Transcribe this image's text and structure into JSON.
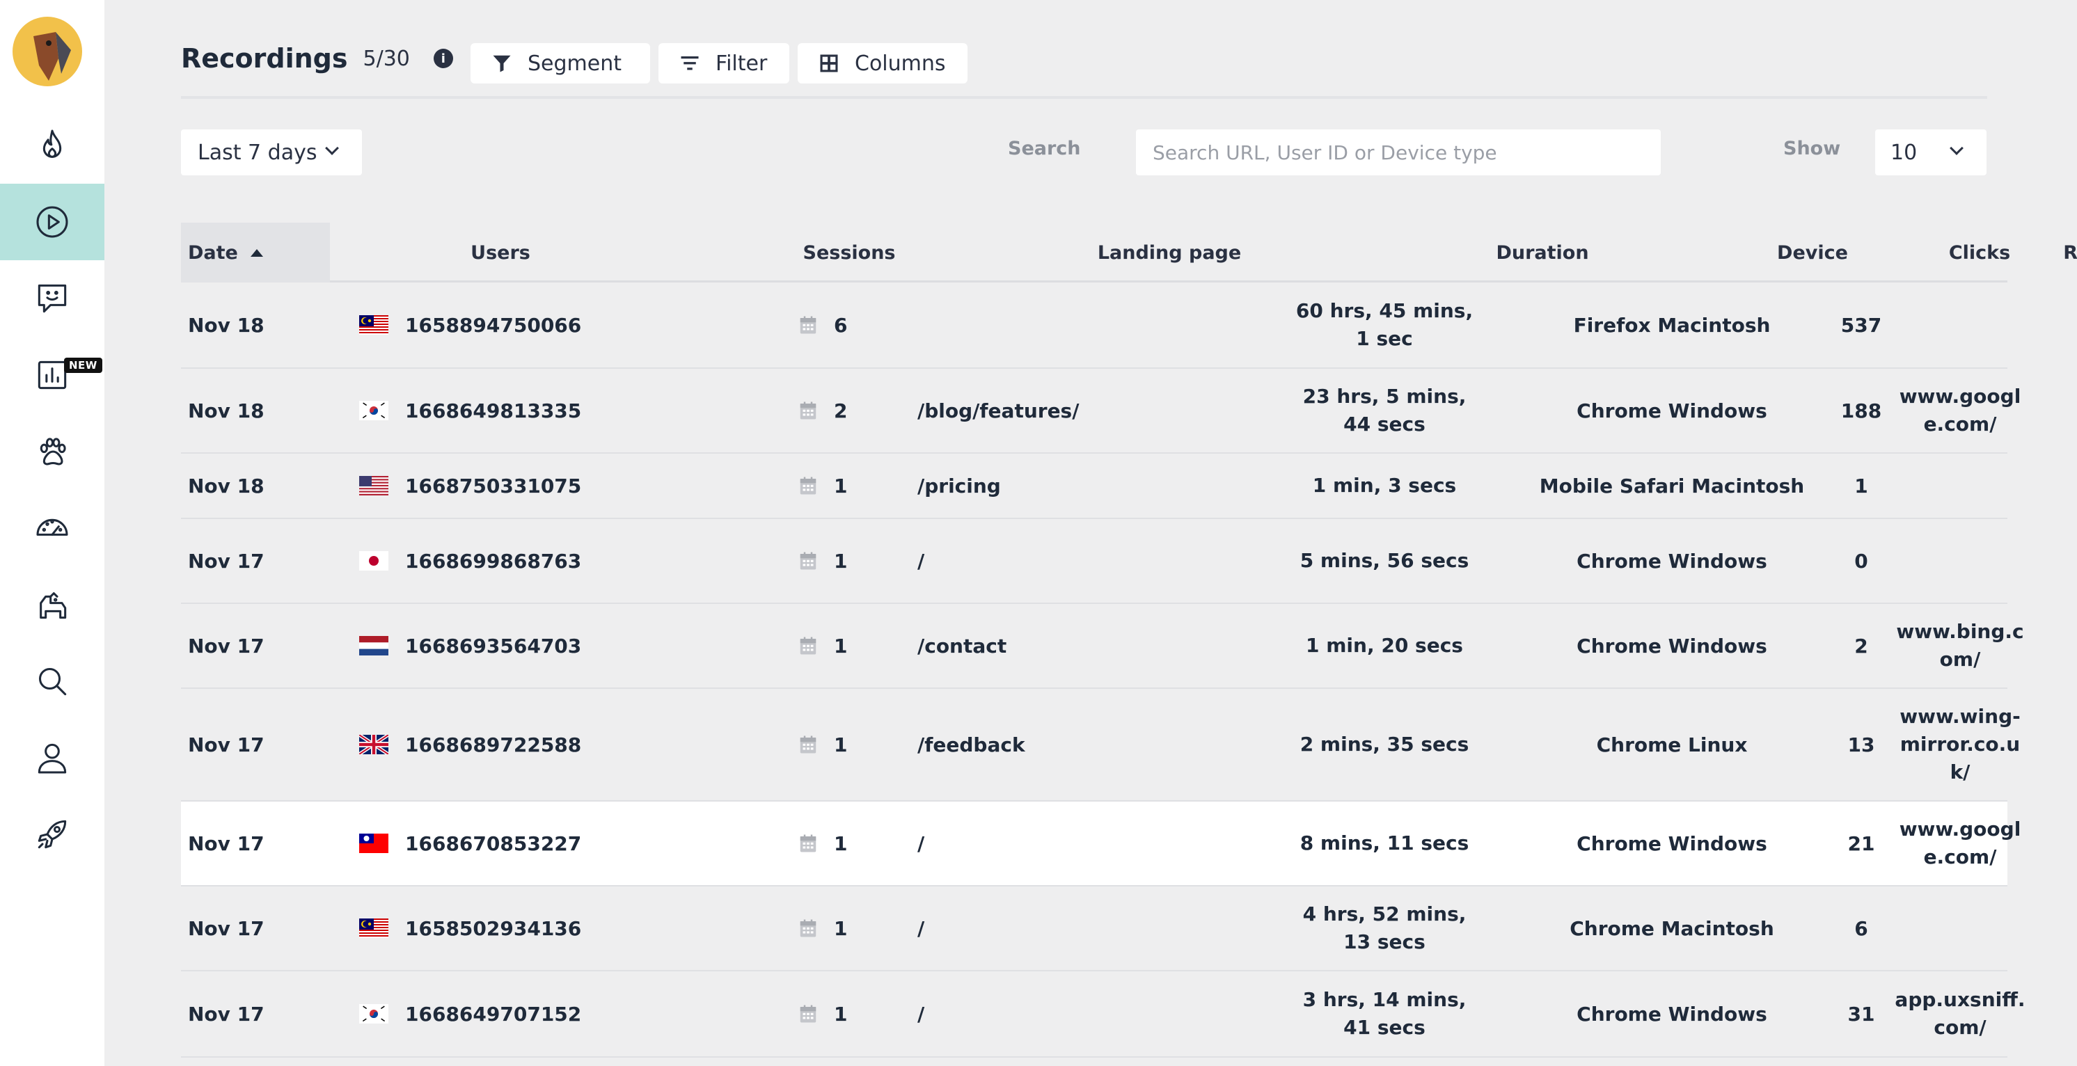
{
  "sidebar": {
    "nav": [
      {
        "icon": "flame-icon",
        "active": false
      },
      {
        "icon": "play-circle-icon",
        "active": true
      },
      {
        "icon": "feedback-chat-icon",
        "active": false
      },
      {
        "icon": "bar-chart-icon",
        "active": false,
        "badge": "NEW"
      },
      {
        "icon": "paw-icon",
        "active": false
      },
      {
        "icon": "gauge-icon",
        "active": false
      },
      {
        "icon": "dog-icon",
        "active": false
      },
      {
        "icon": "search-icon",
        "active": false
      },
      {
        "icon": "user-icon",
        "active": false
      },
      {
        "icon": "rocket-icon",
        "active": false
      }
    ]
  },
  "header": {
    "title": "Recordings",
    "count": "5/30",
    "info_icon": "i",
    "segment_label": "Segment",
    "filter_label": "Filter",
    "columns_label": "Columns"
  },
  "controls": {
    "date_range": "Last 7 days",
    "search_label": "Search",
    "search_placeholder": "Search URL, User ID or Device type",
    "show_label": "Show",
    "show_value": "10"
  },
  "table": {
    "columns": [
      "Date",
      "Users",
      "Sessions",
      "Landing page",
      "Duration",
      "Device",
      "Clicks",
      "Referrer"
    ],
    "rows": [
      {
        "date": "Nov 18",
        "flag": "MY",
        "user": "1658894750066",
        "sessions": "6",
        "landing": "",
        "duration": "60 hrs, 45 mins, 1 sec",
        "device": "Firefox Macintosh",
        "clicks": "537",
        "referrer": ""
      },
      {
        "date": "Nov 18",
        "flag": "KR",
        "user": "1668649813335",
        "sessions": "2",
        "landing": "/blog/features/",
        "duration": "23 hrs, 5 mins, 44 secs",
        "device": "Chrome Windows",
        "clicks": "188",
        "referrer": "www.google.com/"
      },
      {
        "date": "Nov 18",
        "flag": "US",
        "user": "1668750331075",
        "sessions": "1",
        "landing": "/pricing",
        "duration": "1 min, 3 secs",
        "device": "Mobile Safari Macintosh",
        "clicks": "1",
        "referrer": ""
      },
      {
        "date": "Nov 17",
        "flag": "JP",
        "user": "1668699868763",
        "sessions": "1",
        "landing": "/",
        "duration": "5 mins, 56 secs",
        "device": "Chrome Windows",
        "clicks": "0",
        "referrer": ""
      },
      {
        "date": "Nov 17",
        "flag": "NL",
        "user": "1668693564703",
        "sessions": "1",
        "landing": "/contact",
        "duration": "1 min, 20 secs",
        "device": "Chrome Windows",
        "clicks": "2",
        "referrer": "www.bing.com/"
      },
      {
        "date": "Nov 17",
        "flag": "GB",
        "user": "1668689722588",
        "sessions": "1",
        "landing": "/feedback",
        "duration": "2 mins, 35 secs",
        "device": "Chrome Linux",
        "clicks": "13",
        "referrer": "www.wing-mirror.co.uk/"
      },
      {
        "date": "Nov 17",
        "flag": "TW",
        "user": "1668670853227",
        "sessions": "1",
        "landing": "/",
        "duration": "8 mins, 11 secs",
        "device": "Chrome Windows",
        "clicks": "21",
        "referrer": "www.google.com/"
      },
      {
        "date": "Nov 17",
        "flag": "MY",
        "user": "1658502934136",
        "sessions": "1",
        "landing": "/",
        "duration": "4 hrs, 52 mins, 13 secs",
        "device": "Chrome Macintosh",
        "clicks": "6",
        "referrer": ""
      },
      {
        "date": "Nov 17",
        "flag": "KR",
        "user": "1668649707152",
        "sessions": "1",
        "landing": "/",
        "duration": "3 hrs, 14 mins, 41 secs",
        "device": "Chrome Windows",
        "clicks": "31",
        "referrer": "app.uxsniff.com/"
      }
    ]
  }
}
